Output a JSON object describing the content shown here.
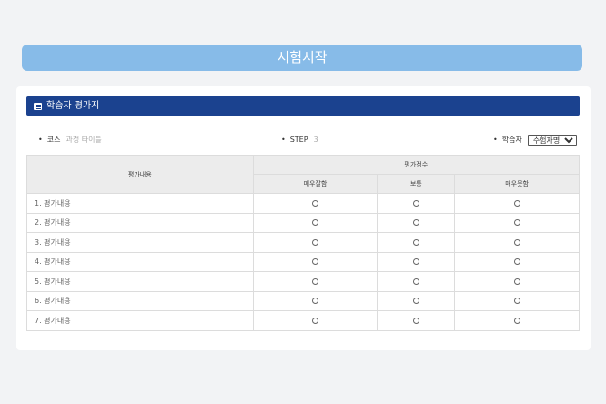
{
  "start_button": "시험시작",
  "card": {
    "title": "학습자 평가지",
    "course": {
      "bullet": "•",
      "label": "코스",
      "value": "과정 타이틀"
    },
    "step": {
      "bullet": "•",
      "label": "STEP",
      "value": "3"
    },
    "learner": {
      "bullet": "•",
      "label": "학습자",
      "selected": "수험자명"
    }
  },
  "table": {
    "header_content": "평가내용",
    "header_score": "평가점수",
    "columns": [
      "매우잘함",
      "보통",
      "매우못함"
    ],
    "rows": [
      "1. 평가내용",
      "2. 평가내용",
      "3. 평가내용",
      "4. 평가내용",
      "5. 평가내용",
      "6. 평가내용",
      "7. 평가내용"
    ]
  }
}
